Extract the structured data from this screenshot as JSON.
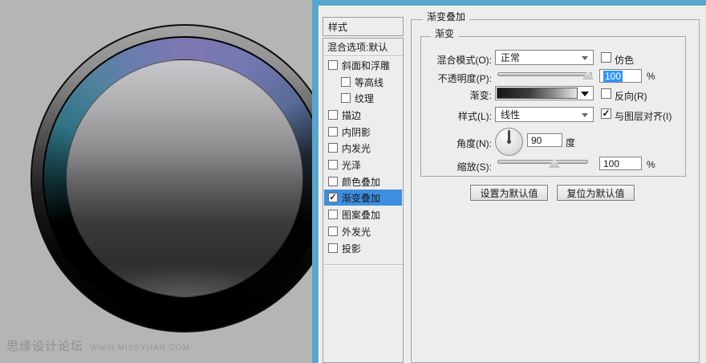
{
  "watermark": {
    "site_name": "思缘设计论坛",
    "site_url": "WWW.MISSYUAN.COM"
  },
  "dialog": {
    "styles_panel": {
      "header": "样式",
      "blending_item": "混合选项:默认",
      "items": [
        {
          "label": "斜面和浮雕",
          "checked": false,
          "indent": false,
          "selected": false
        },
        {
          "label": "等高线",
          "checked": false,
          "indent": true,
          "selected": false
        },
        {
          "label": "纹理",
          "checked": false,
          "indent": true,
          "selected": false
        },
        {
          "label": "描边",
          "checked": false,
          "indent": false,
          "selected": false
        },
        {
          "label": "内阴影",
          "checked": false,
          "indent": false,
          "selected": false
        },
        {
          "label": "内发光",
          "checked": false,
          "indent": false,
          "selected": false
        },
        {
          "label": "光泽",
          "checked": false,
          "indent": false,
          "selected": false
        },
        {
          "label": "颜色叠加",
          "checked": false,
          "indent": false,
          "selected": false
        },
        {
          "label": "渐变叠加",
          "checked": true,
          "indent": false,
          "selected": true
        },
        {
          "label": "图案叠加",
          "checked": false,
          "indent": false,
          "selected": false
        },
        {
          "label": "外发光",
          "checked": false,
          "indent": false,
          "selected": false
        },
        {
          "label": "投影",
          "checked": false,
          "indent": false,
          "selected": false
        }
      ]
    },
    "gradient_overlay": {
      "group_title": "渐变叠加",
      "subgroup_title": "渐变",
      "blend_mode": {
        "label": "混合模式(O):",
        "value": "正常"
      },
      "dither": {
        "label": "仿色",
        "checked": false
      },
      "opacity": {
        "label": "不透明度(P):",
        "value": "100",
        "unit": "%",
        "selected": true
      },
      "gradient": {
        "label": "渐变:",
        "swatch": "black-to-white-linear"
      },
      "reverse": {
        "label": "反向(R)",
        "checked": false
      },
      "style": {
        "label": "样式(L):",
        "value": "线性"
      },
      "align": {
        "label": "与图层对齐(I)",
        "checked": true
      },
      "angle": {
        "label": "角度(N):",
        "value": "90",
        "unit": "度"
      },
      "scale": {
        "label": "缩放(S):",
        "value": "100",
        "unit": "%"
      },
      "buttons": {
        "make_default": "设置为默认值",
        "reset_default": "复位为默认值"
      }
    }
  },
  "colors": {
    "canvas_bg": "#b5b5b5",
    "dialog_bg": "#ededed",
    "window_frame_blue": "#58a6ce",
    "list_selection_blue": "#3d8ee0",
    "input_selection_blue": "#3096fa",
    "knob_accent_purple": "#7e77af",
    "knob_accent_teal": "#2f7385"
  }
}
